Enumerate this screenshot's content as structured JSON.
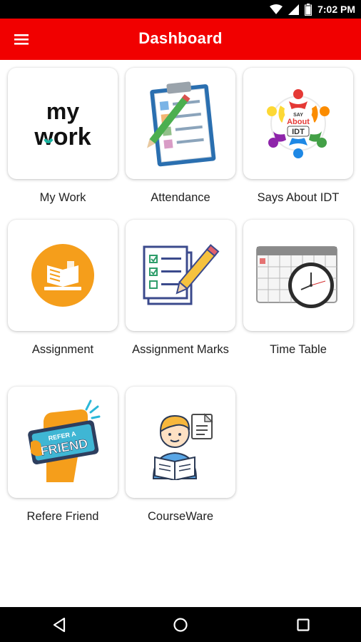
{
  "status_bar": {
    "time": "7:02 PM"
  },
  "app_bar": {
    "title": "Dashboard",
    "accent_color": "#f10000"
  },
  "tiles": [
    {
      "label": "My Work",
      "icon": "my-work-icon",
      "logo_line1": "my",
      "logo_line2": "work"
    },
    {
      "label": "Attendance",
      "icon": "clipboard-attendance-icon"
    },
    {
      "label": "Says About IDT",
      "icon": "says-about-idt-icon",
      "logo_small": "SAY",
      "logo_mid": "About",
      "logo_big": "IDT"
    },
    {
      "label": "Assignment",
      "icon": "assignment-book-icon"
    },
    {
      "label": "Assignment Marks",
      "icon": "checklist-pencil-icon"
    },
    {
      "label": "Time Table",
      "icon": "calendar-clock-icon"
    },
    {
      "label": "Refere Friend",
      "icon": "refer-friend-icon",
      "sign_top": "REFER A",
      "sign_bottom": "FRIEND"
    },
    {
      "label": "CourseWare",
      "icon": "student-reading-icon"
    }
  ],
  "nav": {
    "back": "back-icon",
    "home": "home-icon",
    "recents": "recents-icon"
  }
}
